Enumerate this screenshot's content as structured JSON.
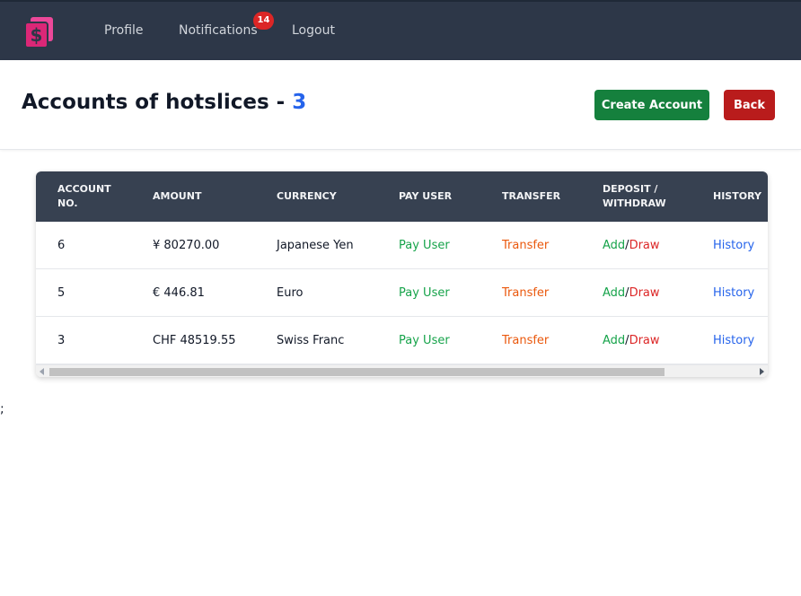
{
  "nav": {
    "logo_icon": "dollar-bill-icon",
    "accent_color": "#db2777",
    "profile_label": "Profile",
    "notifications_label": "Notifications",
    "notifications_count": "14",
    "logout_label": "Logout"
  },
  "header": {
    "title_prefix": "Accounts of hotslices - ",
    "account_count": "3",
    "create_label": "Create Account",
    "back_label": "Back"
  },
  "table": {
    "columns": [
      {
        "line1": "Account",
        "line2": "No."
      },
      {
        "line1": "Amount",
        "line2": ""
      },
      {
        "line1": "Currency",
        "line2": ""
      },
      {
        "line1": "Pay User",
        "line2": ""
      },
      {
        "line1": "Transfer",
        "line2": ""
      },
      {
        "line1": "Deposit /",
        "line2": "Withdraw"
      },
      {
        "line1": "History",
        "line2": ""
      }
    ],
    "rows": [
      {
        "account_no": "6",
        "amount": "¥ 80270.00",
        "currency": "Japanese Yen",
        "pay": "Pay User",
        "transfer": "Transfer",
        "add": "Add",
        "separator": "/",
        "draw": "Draw",
        "history": "History"
      },
      {
        "account_no": "5",
        "amount": "€ 446.81",
        "currency": "Euro",
        "pay": "Pay User",
        "transfer": "Transfer",
        "add": "Add",
        "separator": "/",
        "draw": "Draw",
        "history": "History"
      },
      {
        "account_no": "3",
        "amount": "CHF 48519.55",
        "currency": "Swiss Franc",
        "pay": "Pay User",
        "transfer": "Transfer",
        "add": "Add",
        "separator": "/",
        "draw": "Draw",
        "history": "History"
      }
    ]
  },
  "stray_text": ";"
}
